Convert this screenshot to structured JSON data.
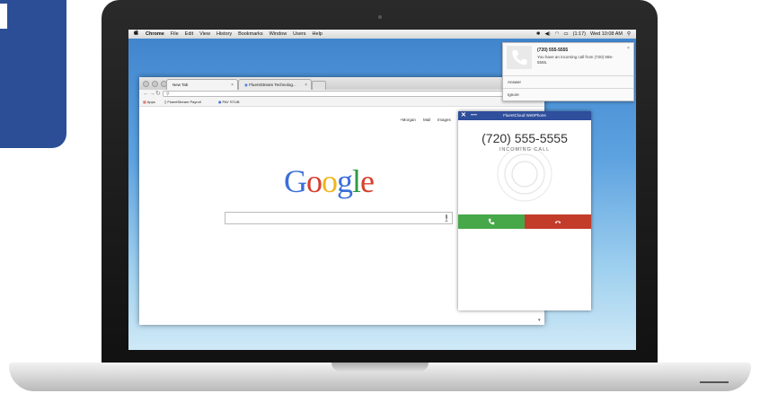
{
  "menubar": {
    "app": "Chrome",
    "items": [
      "File",
      "Edit",
      "View",
      "History",
      "Bookmarks",
      "Window",
      "Users",
      "Help"
    ],
    "battery": "(1:17)",
    "clock": "Wed 10:08 AM"
  },
  "browser": {
    "tabs": [
      {
        "label": "New Tab"
      },
      {
        "label": "FluentStream Technolog..."
      }
    ],
    "tab_close": "×",
    "bookmarks": [
      "Apps",
      "FluentStream Payroll",
      "PAY STUB"
    ],
    "google_links": [
      "+Morgan",
      "Mail",
      "Images"
    ],
    "logo_letters": [
      "G",
      "o",
      "o",
      "g",
      "l",
      "e"
    ],
    "logo_colors": [
      "#3b6fd8",
      "#d6412e",
      "#f2b51c",
      "#3b6fd8",
      "#2e9a44",
      "#d6412e"
    ]
  },
  "webphone": {
    "title": "FluentCloud WebPhone",
    "close": "✕",
    "minimize": "—",
    "number": "(720) 555-5555",
    "status": "INCOMING CALL",
    "answer_color": "#46a848",
    "decline_color": "#c33c2a"
  },
  "notification": {
    "title": "(720) 555-5555",
    "body": "You have an incoming call from (720) 555-5555.",
    "close": "×",
    "answer": "Answer",
    "ignore": "Ignore"
  }
}
